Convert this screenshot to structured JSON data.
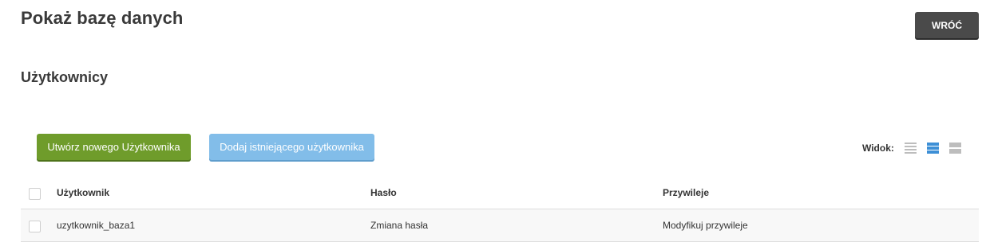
{
  "header": {
    "title": "Pokaż bazę danych",
    "back_label": "WRÓĆ"
  },
  "section": {
    "title": "Użytkownicy"
  },
  "actions": {
    "create_label": "Utwórz nowego Użytkownika",
    "add_existing_label": "Dodaj istniejącego użytkownika"
  },
  "view": {
    "label": "Widok:",
    "options": [
      "view-list-compact-icon",
      "view-list-normal-icon",
      "view-list-wide-icon"
    ],
    "selected": 1
  },
  "table": {
    "columns": [
      "Użytkownik",
      "Hasło",
      "Przywileje"
    ],
    "rows": [
      {
        "user": "uzytkownik_baza1",
        "password": "Zmiana hasła",
        "privileges": "Modyfikuj przywileje"
      }
    ]
  },
  "colors": {
    "primary_green": "#6f9c2b",
    "secondary_blue": "#82bde9",
    "back_button": "#4a4a4a",
    "view_active": "#3d8fd6"
  }
}
